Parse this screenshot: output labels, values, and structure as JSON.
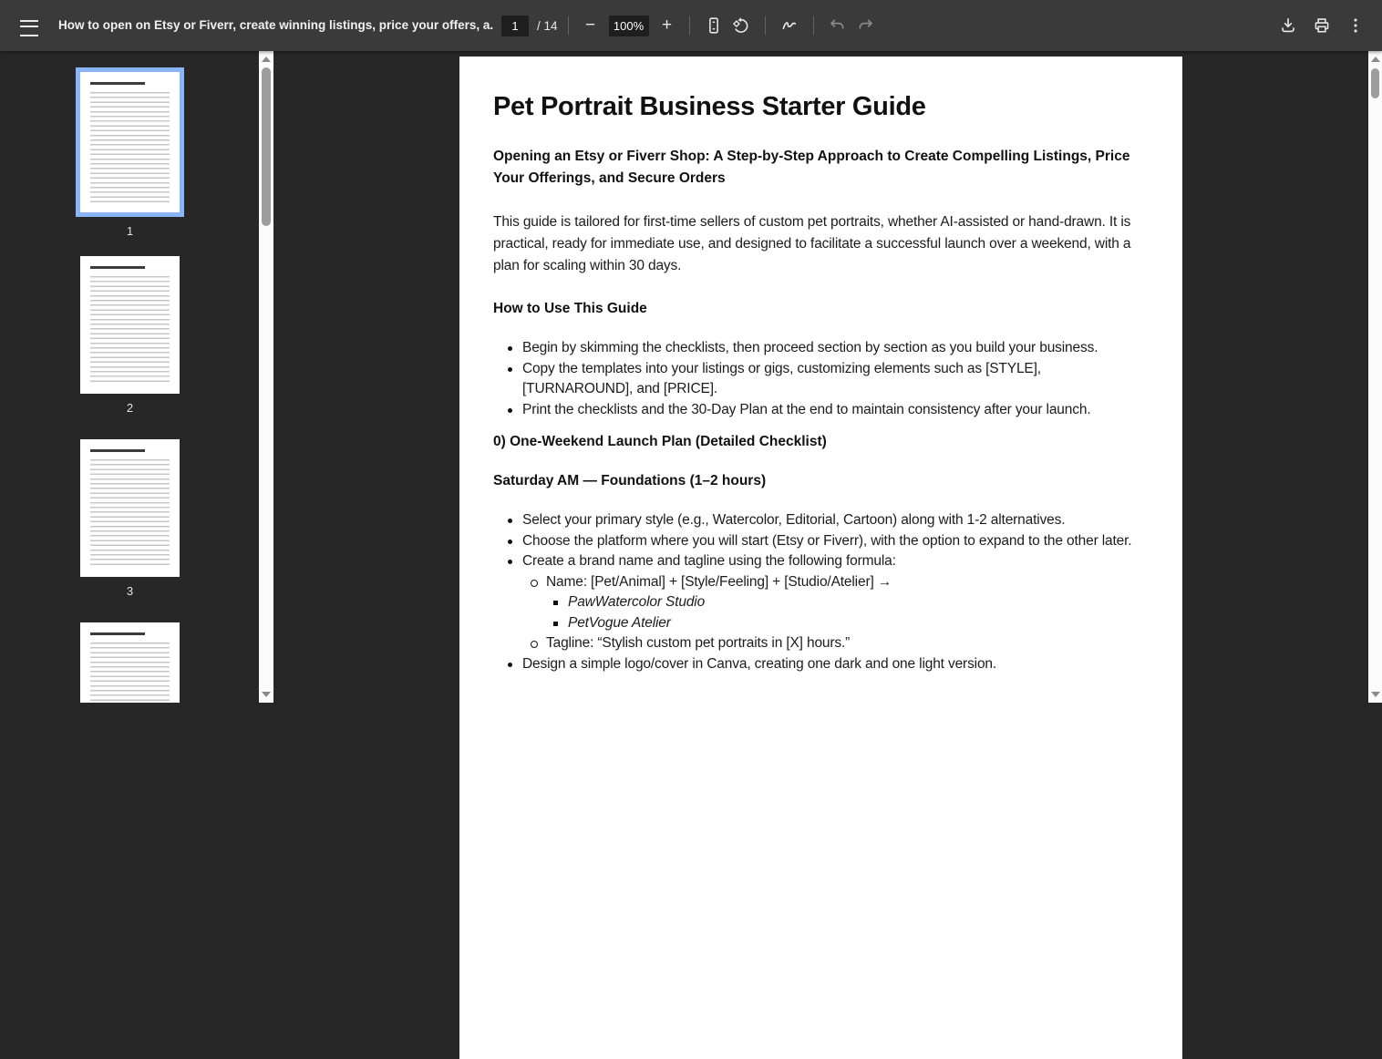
{
  "toolbar": {
    "title": "How to open on Etsy or Fiverr, create winning listings, price your offers, a...",
    "page_current": "1",
    "page_total": "/ 14",
    "zoom_out": "−",
    "zoom_level": "100%",
    "zoom_in": "+"
  },
  "icons": {
    "menu": "hamburger",
    "fit_page": "page-with-vertical-arrows",
    "rotate": "rotate-counterclockwise",
    "annotate": "pen-squiggle",
    "undo": "undo-arrow-disabled",
    "redo": "redo-arrow-disabled",
    "download": "download-arrow-tray",
    "print": "printer",
    "more": "kebab-three-dots"
  },
  "colors": {
    "toolbar_bg": "#3a3a3a",
    "viewer_bg": "#272727",
    "field_bg": "#1e1e1e",
    "accent_selected_thumbnail": "#8ab4f8",
    "scroll_track": "#fbfbfb",
    "page_bg": "#ffffff"
  },
  "sidebar": {
    "thumbnails": [
      {
        "page": "1",
        "selected": true
      },
      {
        "page": "2",
        "selected": false
      },
      {
        "page": "3",
        "selected": false
      },
      {
        "page": "4",
        "selected": false
      }
    ]
  },
  "document": {
    "title": "Pet Portrait Business Starter Guide",
    "subtitle": "Opening an Etsy or Fiverr Shop: A Step-by-Step Approach to Create Compelling Listings, Price Your Offerings, and Secure Orders",
    "intro": "This guide is tailored for first-time sellers of custom pet portraits, whether AI-assisted or hand-drawn. It is practical, ready for immediate use, and designed to facilitate a successful launch over a weekend, with a plan for scaling within 30 days.",
    "how_to_use": {
      "heading": "How to Use This Guide",
      "bullets": [
        "Begin by skimming the checklists, then proceed section by section as you build your business.",
        "Copy the templates into your listings or gigs, customizing elements such as [STYLE], [TURNAROUND], and [PRICE].",
        "Print the checklists and the 30-Day Plan at the end to maintain consistency after your launch."
      ]
    },
    "launch_plan_heading": "0) One-Weekend Launch Plan (Detailed Checklist)",
    "saturday": {
      "heading": "Saturday AM — Foundations (1–2 hours)",
      "select": "Select your primary style (e.g., Watercolor, Editorial, Cartoon) along with 1-2 alternatives.",
      "choose": "Choose the platform where you will start (Etsy or Fiverr), with the option to expand to the other later.",
      "create": "Create a brand name and tagline using the following formula:",
      "name_formula": "Name: [Pet/Animal] + [Style/Feeling] + [Studio/Atelier] →",
      "example1": "PawWatercolor Studio",
      "example2": "PetVogue Atelier",
      "tagline": "Tagline: “Stylish custom pet portraits in [X] hours.”",
      "design": "Design a simple logo/cover in Canva, creating one dark and one light version."
    }
  }
}
